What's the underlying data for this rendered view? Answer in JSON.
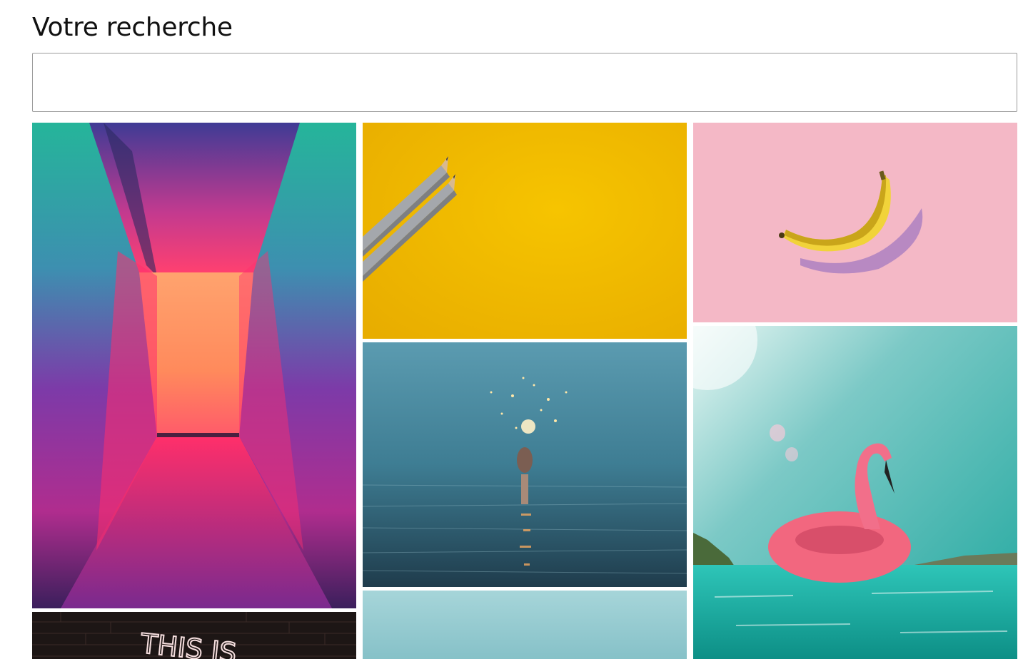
{
  "search": {
    "label": "Votre recherche",
    "value": ""
  },
  "gallery": {
    "images": [
      {
        "subject": "neon-corridor"
      },
      {
        "subject": "pencils-on-yellow"
      },
      {
        "subject": "banana-on-pink"
      },
      {
        "subject": "sparkler-in-sea"
      },
      {
        "subject": "flamingo-float"
      },
      {
        "subject": "neon-sign-brick-wall",
        "text": "THIS IS"
      },
      {
        "subject": "light-blue-sky"
      }
    ]
  }
}
